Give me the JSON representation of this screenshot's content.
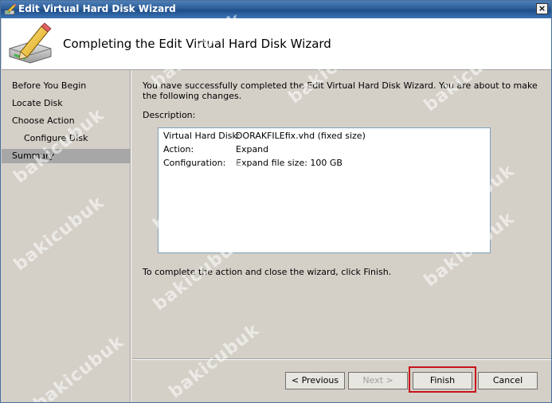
{
  "window": {
    "title": "Edit Virtual Hard Disk Wizard",
    "close_label": "×"
  },
  "header": {
    "title": "Completing the Edit Virtual Hard Disk Wizard"
  },
  "sidebar": {
    "items": [
      {
        "label": "Before You Begin"
      },
      {
        "label": "Locate Disk"
      },
      {
        "label": "Choose Action"
      },
      {
        "label": "Configure Disk"
      },
      {
        "label": "Summary"
      }
    ],
    "selected": "Summary"
  },
  "main": {
    "intro": "You have successfully completed the Edit Virtual Hard Disk Wizard. You are about to make the following changes.",
    "description_label": "Description:",
    "description": [
      {
        "key": "Virtual Hard Disk:",
        "value": "DORAKFILEfix.vhd (fixed size)"
      },
      {
        "key": "Action:",
        "value": "Expand"
      },
      {
        "key": "Configuration:",
        "value": "Expand file size: 100 GB"
      }
    ],
    "outro": "To complete the action and close the wizard, click Finish."
  },
  "buttons": {
    "previous": "< Previous",
    "next": "Next >",
    "finish": "Finish",
    "cancel": "Cancel"
  },
  "watermark": {
    "text": "bakicubuk"
  },
  "colors": {
    "selection": "#a7a7a7",
    "highlight_border": "#c8121a",
    "titlebar": "#2b5c97"
  }
}
